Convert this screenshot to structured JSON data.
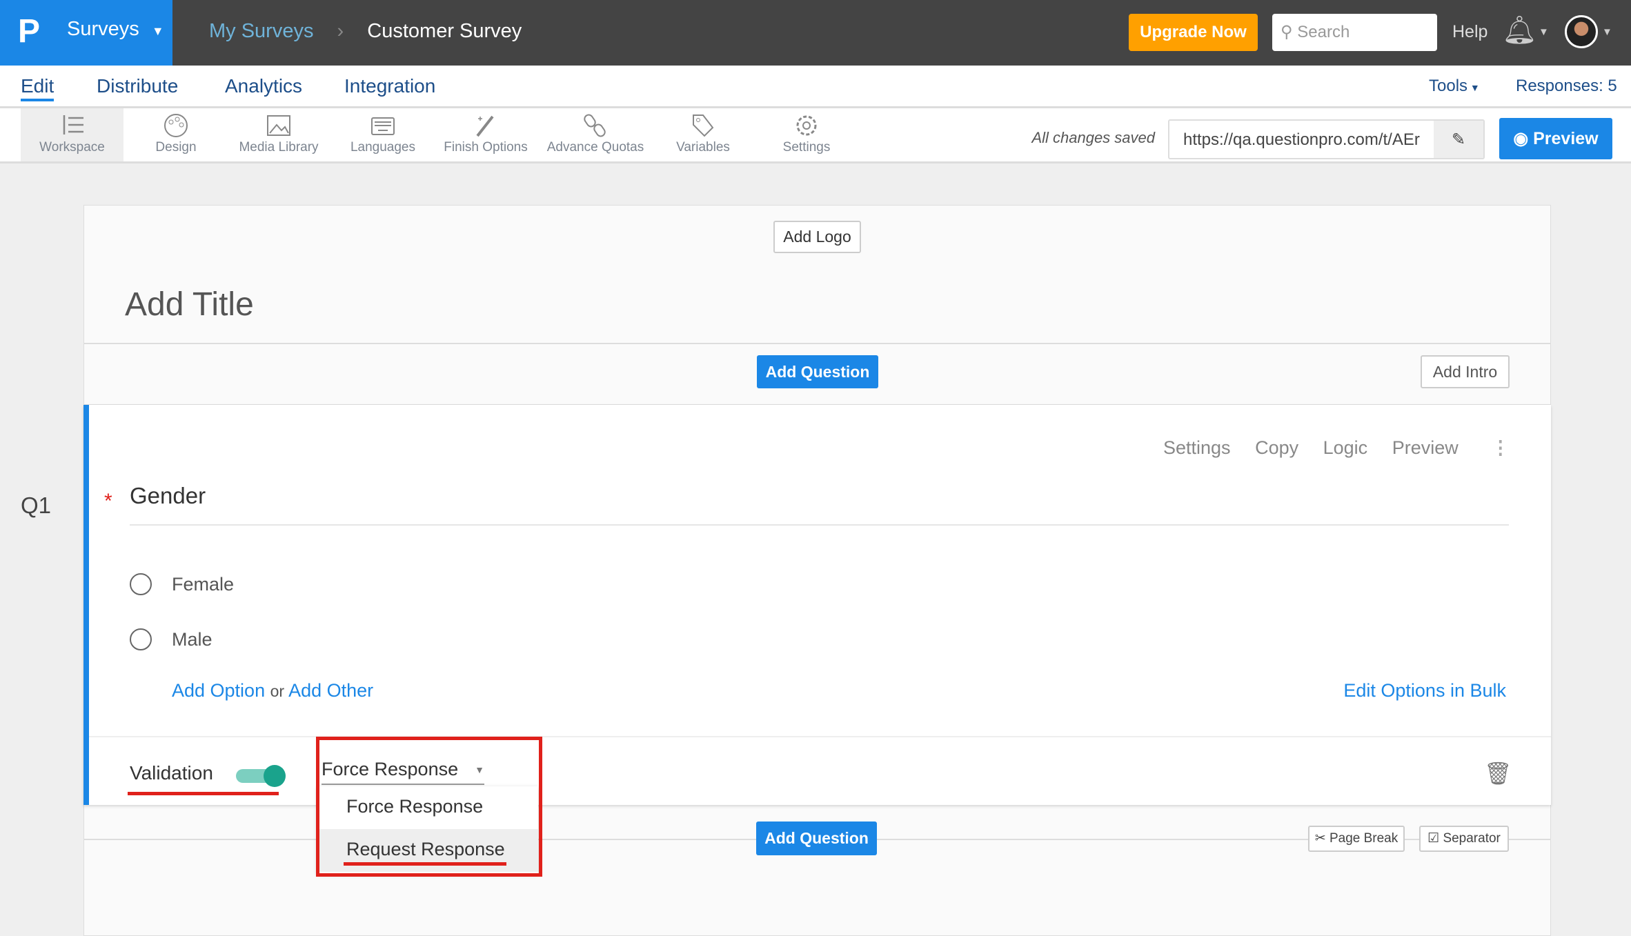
{
  "topbar": {
    "brand_menu": "Surveys",
    "breadcrumb": [
      "My Surveys",
      "Customer Survey"
    ],
    "upgrade": "Upgrade Now",
    "search_placeholder": "Search",
    "help": "Help"
  },
  "nav": {
    "tabs": [
      "Edit",
      "Distribute",
      "Analytics",
      "Integration"
    ],
    "active": "Edit",
    "tools": "Tools",
    "responses": "Responses: 5"
  },
  "toolbar": {
    "items": [
      {
        "label": "Workspace",
        "icon": "workspace-icon"
      },
      {
        "label": "Design",
        "icon": "palette-icon"
      },
      {
        "label": "Media Library",
        "icon": "image-icon"
      },
      {
        "label": "Languages",
        "icon": "keyboard-icon"
      },
      {
        "label": "Finish Options",
        "icon": "magic-wand-icon"
      },
      {
        "label": "Advance Quotas",
        "icon": "link-icon"
      },
      {
        "label": "Variables",
        "icon": "tag-icon"
      },
      {
        "label": "Settings",
        "icon": "gear-icon"
      }
    ],
    "status": "All changes saved",
    "url": "https://qa.questionpro.com/t/AEr",
    "preview": "Preview"
  },
  "survey": {
    "add_logo": "Add Logo",
    "title": "Add Title",
    "add_question": "Add Question",
    "add_intro": "Add Intro",
    "question": {
      "number": "Q1",
      "text": "Gender",
      "required": true,
      "actions": [
        "Settings",
        "Copy",
        "Logic",
        "Preview"
      ],
      "options": [
        "Female",
        "Male"
      ],
      "add_option": "Add Option",
      "or": "or",
      "add_other": "Add Other",
      "edit_bulk": "Edit Options in Bulk",
      "validation_label": "Validation",
      "validation_on": true,
      "validation_type": "Force Response",
      "dropdown_options": [
        "Force Response",
        "Request Response"
      ]
    },
    "page_break": "Page Break",
    "separator": "Separator"
  },
  "colors": {
    "brand": "#1b87e6",
    "upgrade": "#ffa000",
    "toggle": "#1aa38c",
    "highlight": "#e0211b"
  }
}
